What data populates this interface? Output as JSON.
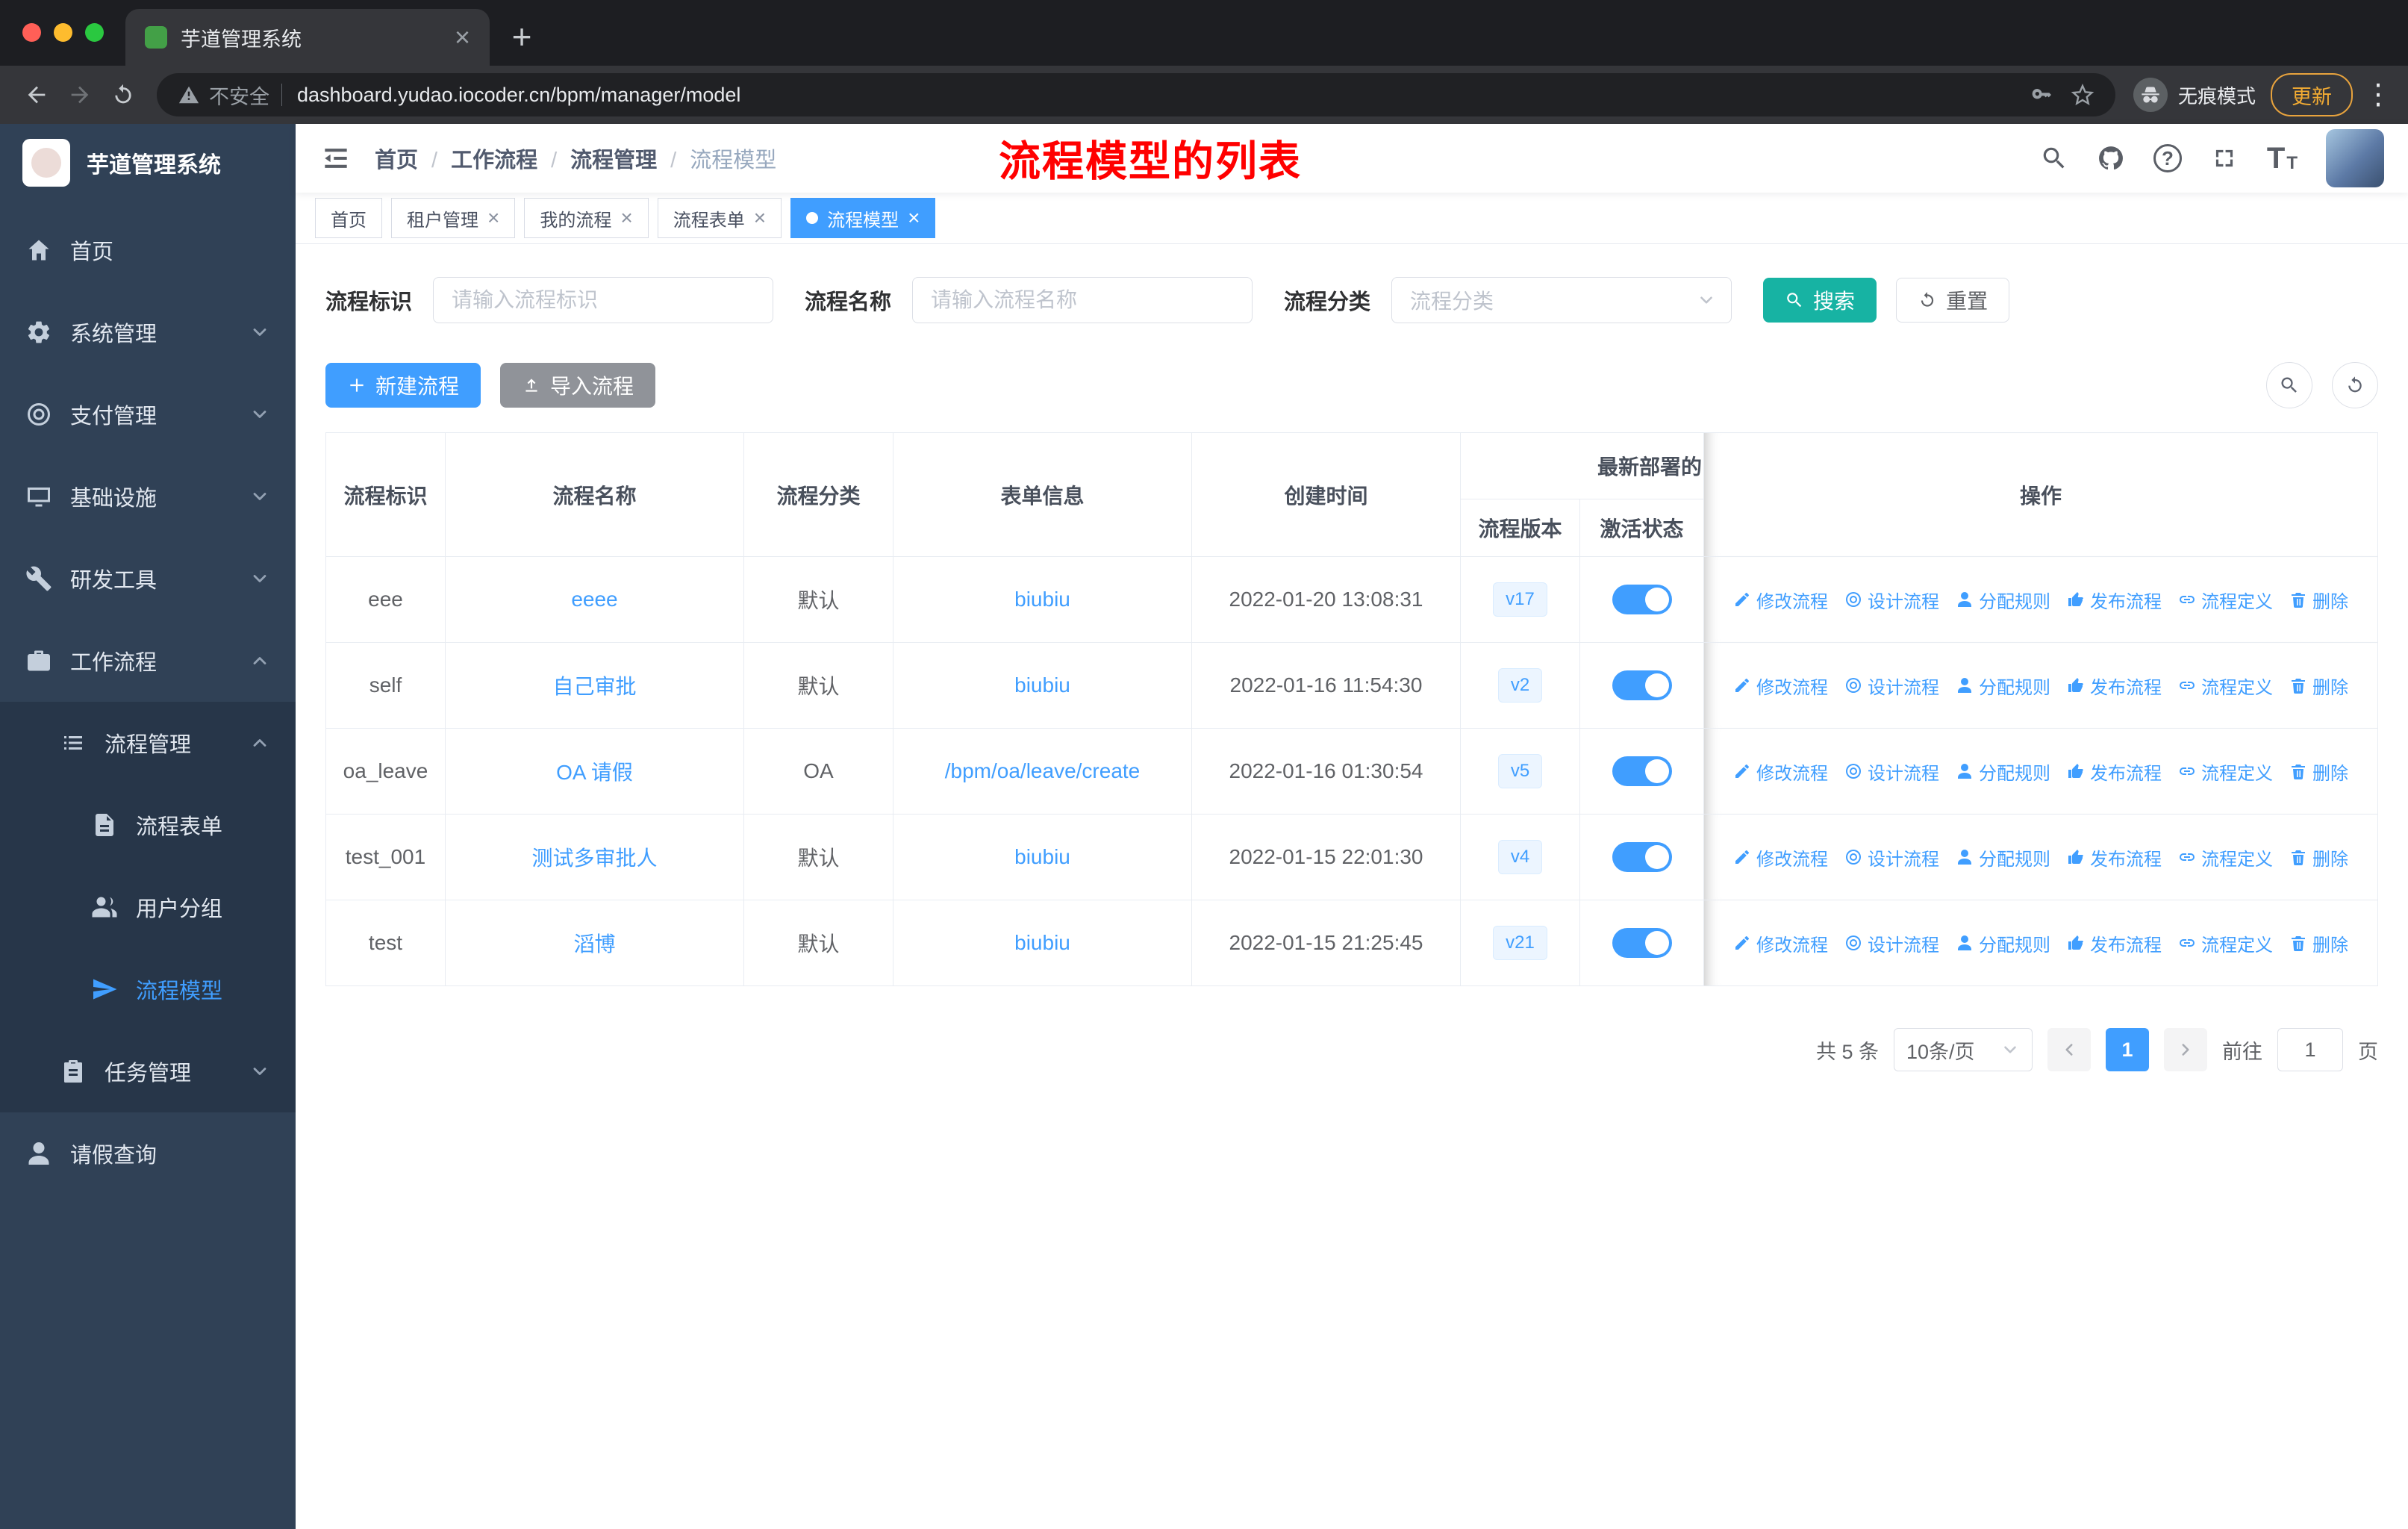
{
  "colors": {
    "accent": "#409eff",
    "teal": "#17b3a3",
    "graybtn": "#909399",
    "sidebar": "#304156",
    "sidebarsub": "#273649",
    "annotation": "#ff0000"
  },
  "browser": {
    "tab_title": "芋道管理系统",
    "security_label": "不安全",
    "url": "dashboard.yudao.iocoder.cn/bpm/manager/model",
    "incognito_label": "无痕模式",
    "update_label": "更新"
  },
  "sidebar": {
    "logo_title": "芋道管理系统",
    "items": [
      {
        "label": "首页"
      },
      {
        "label": "系统管理"
      },
      {
        "label": "支付管理"
      },
      {
        "label": "基础设施"
      },
      {
        "label": "研发工具"
      },
      {
        "label": "工作流程"
      },
      {
        "label": "流程管理"
      },
      {
        "label": "流程表单"
      },
      {
        "label": "用户分组"
      },
      {
        "label": "流程模型"
      },
      {
        "label": "任务管理"
      },
      {
        "label": "请假查询"
      }
    ]
  },
  "header": {
    "breadcrumb": [
      "首页",
      "工作流程",
      "流程管理",
      "流程模型"
    ],
    "annotation": "流程模型的列表"
  },
  "tags": [
    {
      "label": "首页"
    },
    {
      "label": "租户管理"
    },
    {
      "label": "我的流程"
    },
    {
      "label": "流程表单"
    },
    {
      "label": "流程模型"
    }
  ],
  "filters": {
    "id_label": "流程标识",
    "id_placeholder": "请输入流程标识",
    "name_label": "流程名称",
    "name_placeholder": "请输入流程名称",
    "category_label": "流程分类",
    "category_placeholder": "流程分类",
    "search_label": "搜索",
    "reset_label": "重置"
  },
  "toolbar": {
    "create_label": "新建流程",
    "import_label": "导入流程"
  },
  "table": {
    "headers": {
      "id": "流程标识",
      "name": "流程名称",
      "category": "流程分类",
      "form": "表单信息",
      "created": "创建时间",
      "deploy": "最新部署的",
      "version": "流程版本",
      "active": "激活状态",
      "actions": "操作"
    },
    "ops": [
      "修改流程",
      "设计流程",
      "分配规则",
      "发布流程",
      "流程定义",
      "删除"
    ],
    "rows": [
      {
        "id": "eee",
        "name": "eeee",
        "category": "默认",
        "form": "biubiu",
        "created": "2022-01-20 13:08:31",
        "version": "v17"
      },
      {
        "id": "self",
        "name": "自己审批",
        "category": "默认",
        "form": "biubiu",
        "created": "2022-01-16 11:54:30",
        "version": "v2"
      },
      {
        "id": "oa_leave",
        "name": "OA 请假",
        "category": "OA",
        "form": "/bpm/oa/leave/create",
        "created": "2022-01-16 01:30:54",
        "version": "v5"
      },
      {
        "id": "test_001",
        "name": "测试多审批人",
        "category": "默认",
        "form": "biubiu",
        "created": "2022-01-15 22:01:30",
        "version": "v4"
      },
      {
        "id": "test",
        "name": "滔博",
        "category": "默认",
        "form": "biubiu",
        "created": "2022-01-15 21:25:45",
        "version": "v21"
      }
    ]
  },
  "pagination": {
    "total": "共 5 条",
    "page_size": "10条/页",
    "current": "1",
    "goto_label": "前往",
    "goto_value": "1",
    "unit_label": "页"
  }
}
